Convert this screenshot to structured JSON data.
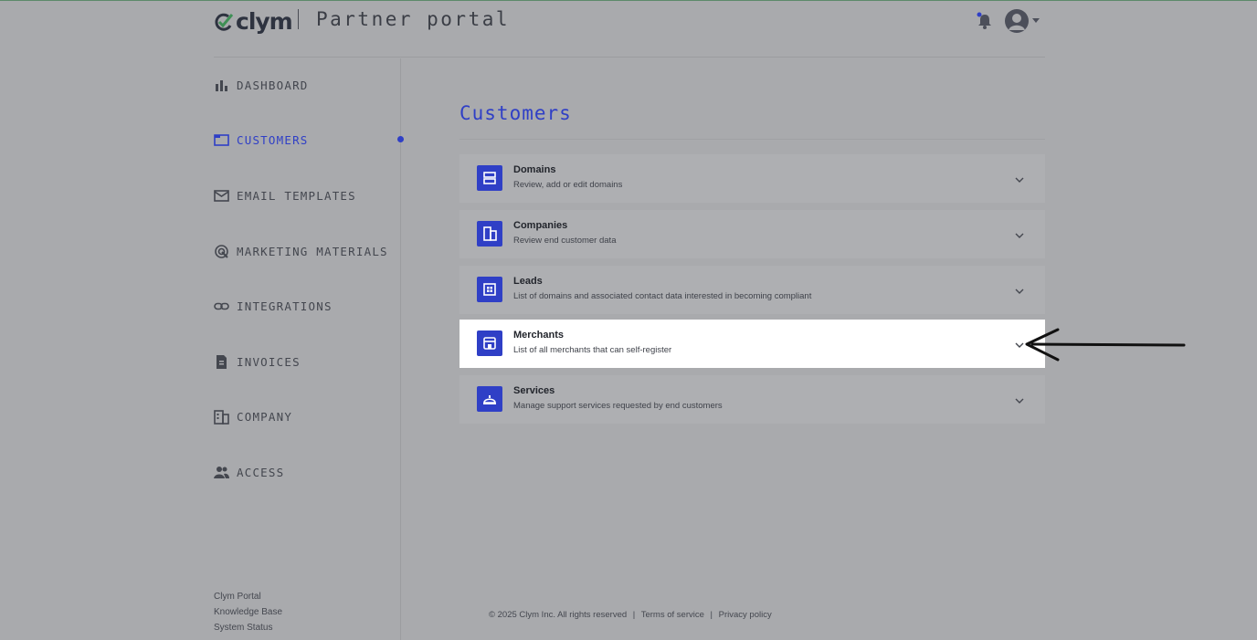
{
  "header": {
    "logo_text": "clym",
    "portal_title": "Partner portal"
  },
  "sidebar": {
    "items": [
      {
        "label": "DASHBOARD",
        "icon": "bar-chart-icon"
      },
      {
        "label": "CUSTOMERS",
        "icon": "folder-icon",
        "active": true
      },
      {
        "label": "EMAIL TEMPLATES",
        "icon": "mail-icon"
      },
      {
        "label": "MARKETING MATERIALS",
        "icon": "target-icon"
      },
      {
        "label": "INTEGRATIONS",
        "icon": "link-icon"
      },
      {
        "label": "INVOICES",
        "icon": "document-icon"
      },
      {
        "label": "COMPANY",
        "icon": "building-icon"
      },
      {
        "label": "ACCESS",
        "icon": "people-icon"
      }
    ],
    "links": [
      "Clym Portal",
      "Knowledge Base",
      "System Status"
    ]
  },
  "main": {
    "title": "Customers",
    "cards": [
      {
        "title": "Domains",
        "desc": "Review, add or edit domains",
        "icon": "server-icon"
      },
      {
        "title": "Companies",
        "desc": "Review end customer data",
        "icon": "building-icon"
      },
      {
        "title": "Leads",
        "desc": "List of domains and associated contact data interested in becoming compliant",
        "icon": "grid-icon"
      },
      {
        "title": "Merchants",
        "desc": "List of all merchants that can self-register",
        "icon": "store-icon",
        "highlighted": true
      },
      {
        "title": "Services",
        "desc": "Manage support services requested by end customers",
        "icon": "service-bell-icon"
      }
    ]
  },
  "footer": {
    "copyright": "© 2025 Clym Inc. All rights reserved",
    "sep": "|",
    "terms": "Terms of service",
    "privacy": "Privacy policy"
  },
  "colors": {
    "accent": "#2f3fc6",
    "background": "#a9aaad",
    "highlight_card": "#ffffff"
  }
}
